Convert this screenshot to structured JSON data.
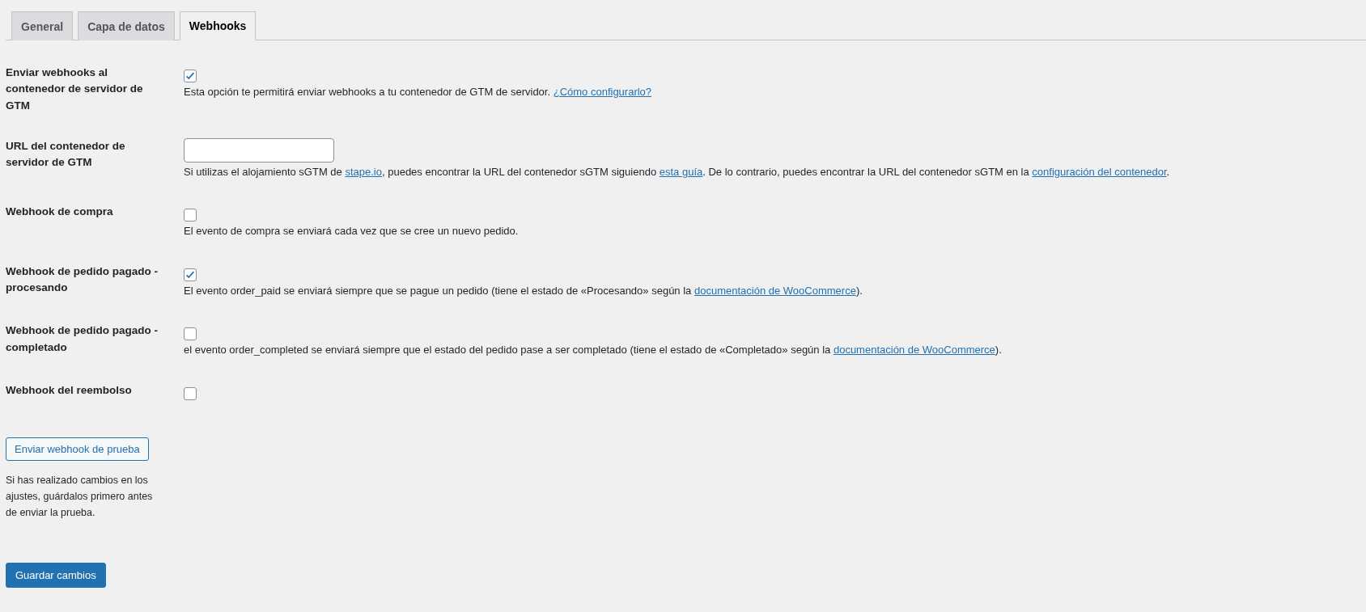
{
  "tabs": [
    {
      "label": "General",
      "selected": false
    },
    {
      "label": "Capa de datos",
      "selected": false
    },
    {
      "label": "Webhooks",
      "selected": true
    }
  ],
  "settings": [
    {
      "label": "Enviar webhooks al contenedor de servidor de GTM",
      "kind": "checkbox",
      "checked": true,
      "description": [
        {
          "text": "Esta opción te permitirá enviar webhooks a tu contenedor de GTM de servidor. ",
          "link": false
        },
        {
          "text": "¿Cómo configurarlo?",
          "link": true
        }
      ]
    },
    {
      "label": "URL del contenedor de servidor de GTM",
      "kind": "text",
      "description": [
        {
          "text": "Si utilizas el alojamiento sGTM de ",
          "link": false
        },
        {
          "text": "stape.io",
          "link": true
        },
        {
          "text": ", puedes encontrar la URL del contenedor sGTM siguiendo ",
          "link": false
        },
        {
          "text": "esta guía",
          "link": true
        },
        {
          "text": ". De lo contrario, puedes encontrar la URL del contenedor sGTM en la ",
          "link": false
        },
        {
          "text": "configuración del contenedor",
          "link": true
        },
        {
          "text": ".",
          "link": false
        }
      ]
    },
    {
      "label": "Webhook de compra",
      "kind": "checkbox",
      "checked": false,
      "description": [
        {
          "text": "El evento de compra se enviará cada vez que se cree un nuevo pedido.",
          "link": false
        }
      ]
    },
    {
      "label": "Webhook de pedido pagado - procesando",
      "kind": "checkbox",
      "checked": true,
      "description": [
        {
          "text": "El evento order_paid se enviará siempre que se pague un pedido (tiene el estado de «Procesando» según la ",
          "link": false
        },
        {
          "text": "documentación de WooCommerce",
          "link": true
        },
        {
          "text": ").",
          "link": false
        }
      ]
    },
    {
      "label": "Webhook de pedido pagado - completado",
      "kind": "checkbox",
      "checked": false,
      "description": [
        {
          "text": "el evento order_completed se enviará siempre que el estado del pedido pase a ser completado (tiene el estado de «Completado» según la ",
          "link": false
        },
        {
          "text": "documentación de WooCommerce",
          "link": true
        },
        {
          "text": ").",
          "link": false
        }
      ]
    },
    {
      "label": "Webhook del reembolso",
      "kind": "checkbox",
      "checked": false
    }
  ],
  "test_button": "Enviar webhook de prueba",
  "test_note": "Si has realizado cambios en los ajustes, guárdalos primero antes de enviar la prueba.",
  "save_button": "Guardar cambios"
}
